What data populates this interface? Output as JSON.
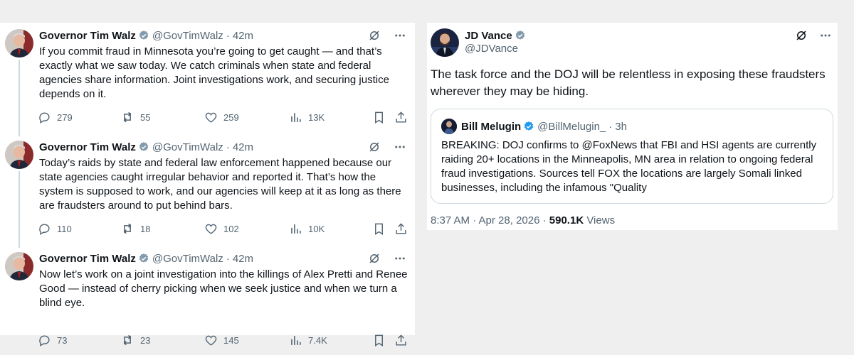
{
  "left_thread": {
    "tweets": [
      {
        "name": "Governor Tim Walz",
        "handle": "@GovTimWalz",
        "dot": "·",
        "time": "42m",
        "text": "If you commit fraud in Minnesota you’re going to get caught — and that’s exactly what we saw today. We catch criminals when state and federal agencies share information. Joint investigations work, and securing justice depends on it.",
        "replies": "279",
        "reposts": "55",
        "likes": "259",
        "views": "13K"
      },
      {
        "name": "Governor Tim Walz",
        "handle": "@GovTimWalz",
        "dot": "·",
        "time": "42m",
        "text": "Today’s raids by state and federal law enforcement happened because our state agencies caught irregular behavior and reported it. That’s how the system is supposed to work, and our agencies will keep at it as long as there are fraudsters around to put behind bars.",
        "replies": "110",
        "reposts": "18",
        "likes": "102",
        "views": "10K"
      },
      {
        "name": "Governor Tim Walz",
        "handle": "@GovTimWalz",
        "dot": "·",
        "time": "42m",
        "text": "Now let’s work on a joint investigation into the killings of Alex Pretti and Renee Good — instead of cherry picking when we seek justice and when we turn a blind eye.",
        "replies": "73",
        "reposts": "23",
        "likes": "145",
        "views": "7.4K"
      }
    ]
  },
  "right_post": {
    "name": "JD Vance",
    "handle": "@JDVance",
    "text": "The task force and the DOJ will be relentless in exposing these fraudsters wherever they may be hiding.",
    "quote": {
      "name": "Bill Melugin",
      "handle": "@BillMelugin_",
      "dot": "·",
      "time": "3h",
      "text": "BREAKING: DOJ confirms to @FoxNews that FBI and HSI agents are currently raiding 20+ locations in the Minneapolis, MN area in relation to ongoing federal fraud investigations. Sources tell FOX the locations are largely Somali linked businesses, including the infamous \"Quality"
    },
    "timestamp": "8:37 AM · Apr 28, 2026 ·",
    "views_count": "590.1K",
    "views_label": "Views"
  },
  "colors": {
    "gold_badge": "#e2b719",
    "blue_badge": "#1d9bf0",
    "icon_gray": "#536471",
    "text": "#0f1419",
    "border": "#cfd9de",
    "background": "#efefef"
  },
  "icons": {
    "reply": "reply-icon",
    "repost": "repost-icon",
    "like": "heart-icon",
    "views": "views-chart-icon",
    "bookmark": "bookmark-icon",
    "share": "share-icon",
    "grok": "grok-icon",
    "more": "more-icon",
    "verified": "verified-badge-icon"
  }
}
